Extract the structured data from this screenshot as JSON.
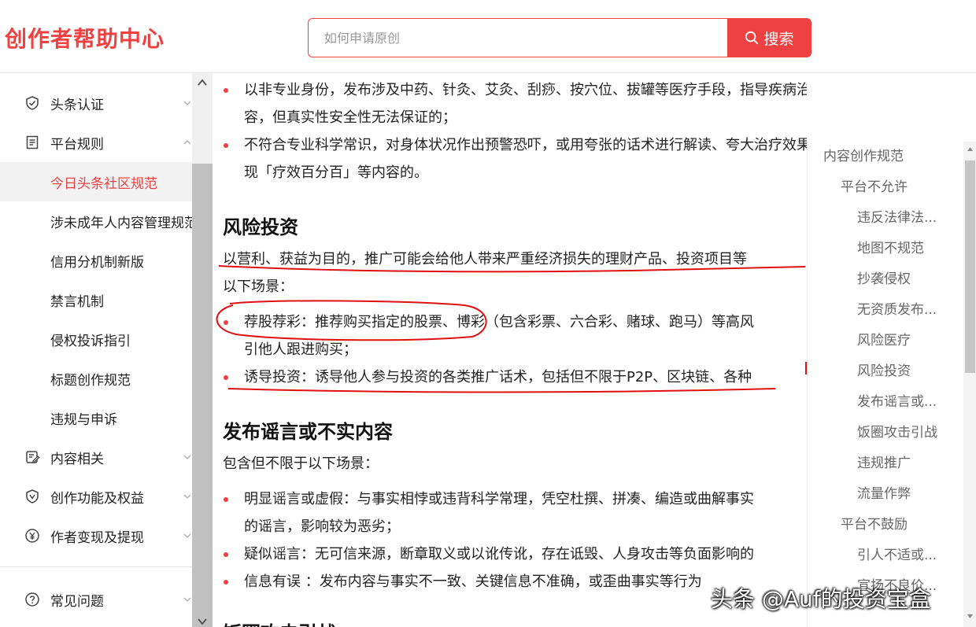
{
  "header": {
    "logo": "创作者帮助中心",
    "search_placeholder": "如何申请原创",
    "search_button": "搜索"
  },
  "sidebar": {
    "items": [
      {
        "label": "头条认证",
        "icon": "shield-check-icon",
        "chevron": "down"
      },
      {
        "label": "平台规则",
        "icon": "document-list-icon",
        "chevron": "up"
      },
      {
        "label": "今日头条社区规范",
        "active": true
      },
      {
        "label": "涉未成年人内容管理规范"
      },
      {
        "label": "信用分机制新版"
      },
      {
        "label": "禁言机制"
      },
      {
        "label": "侵权投诉指引"
      },
      {
        "label": "标题创作规范"
      },
      {
        "label": "违规与申诉"
      },
      {
        "label": "内容相关",
        "icon": "edit-document-icon",
        "chevron": "down"
      },
      {
        "label": "创作功能及权益",
        "icon": "shield-v-icon",
        "chevron": "down"
      },
      {
        "label": "作者变现及提现",
        "icon": "yen-circle-icon",
        "chevron": "down"
      },
      {
        "label": "常见问题",
        "icon": "question-circle-icon",
        "chevron": "down"
      }
    ]
  },
  "content": {
    "item1_line1": "以非专业身份，发布涉及中药、针灸、艾灸、刮痧、按穴位、拔罐等医疗手段，指导疾病治疗的内",
    "item1_line2": "容，但真实性安全性无法保证的；",
    "item2_line1": "不符合专业科学常识，对身体状况作出预警恐吓，或用夸张的话术进行解读、夸大治疗效果，如出",
    "item2_line2": "现「疗效百分百」等内容的。",
    "heading_risk_invest": "风险投资",
    "risk_intro_line1": "以营利、获益为目的，推广可能会给他人带来严重经济损失的理财产品、投资项目等",
    "risk_intro_line2": "以下场景：",
    "risk_item1_line1": "荐股荐彩：推荐购买指定的股票、博彩（包含彩票、六合彩、赌球、跑马）等高风",
    "risk_item1_line2": "引他人跟进购买；",
    "risk_item2_line1": "诱导投资：诱导他人参与投资的各类推广话术，包括但不限于P2P、区块链、各种",
    "heading_rumor": "发布谣言或不实内容",
    "rumor_intro": "包含但不限于以下场景：",
    "rumor_item1_line1": "明显谣言或虚假：与事实相悖或违背科学常理，凭空杜撰、拼凑、编造或曲解事实",
    "rumor_item1_line2": "的谣言，影响较为恶劣；",
    "rumor_item2_line1": "疑似谣言：无可信来源，断章取义或以讹传讹，存在诋毁、人身攻击等负面影响的",
    "rumor_item3_line1": "信息有误 ：发布内容与事实不一致、关键信息不准确，或歪曲事实等行为",
    "heading_next_partial": "饭圈攻击引战"
  },
  "toc": {
    "items": [
      {
        "label": "内容创作规范",
        "level": 0
      },
      {
        "label": "平台不允许",
        "level": 1
      },
      {
        "label": "违反法律法...",
        "level": 2
      },
      {
        "label": "地图不规范",
        "level": 2
      },
      {
        "label": "抄袭侵权",
        "level": 2
      },
      {
        "label": "无资质发布...",
        "level": 2
      },
      {
        "label": "风险医疗",
        "level": 2
      },
      {
        "label": "风险投资",
        "level": 2
      },
      {
        "label": "发布谣言或...",
        "level": 2
      },
      {
        "label": "饭圈攻击引战",
        "level": 2
      },
      {
        "label": "违规推广",
        "level": 2
      },
      {
        "label": "流量作弊",
        "level": 2
      },
      {
        "label": "平台不鼓励",
        "level": 1
      },
      {
        "label": "引人不适或...",
        "level": 2
      },
      {
        "label": "宣扬不良价...",
        "level": 2
      }
    ]
  },
  "watermark": "头条 @Auf的投资宝盒",
  "colors": {
    "accent": "#f04142",
    "annotation": "#e01010"
  }
}
